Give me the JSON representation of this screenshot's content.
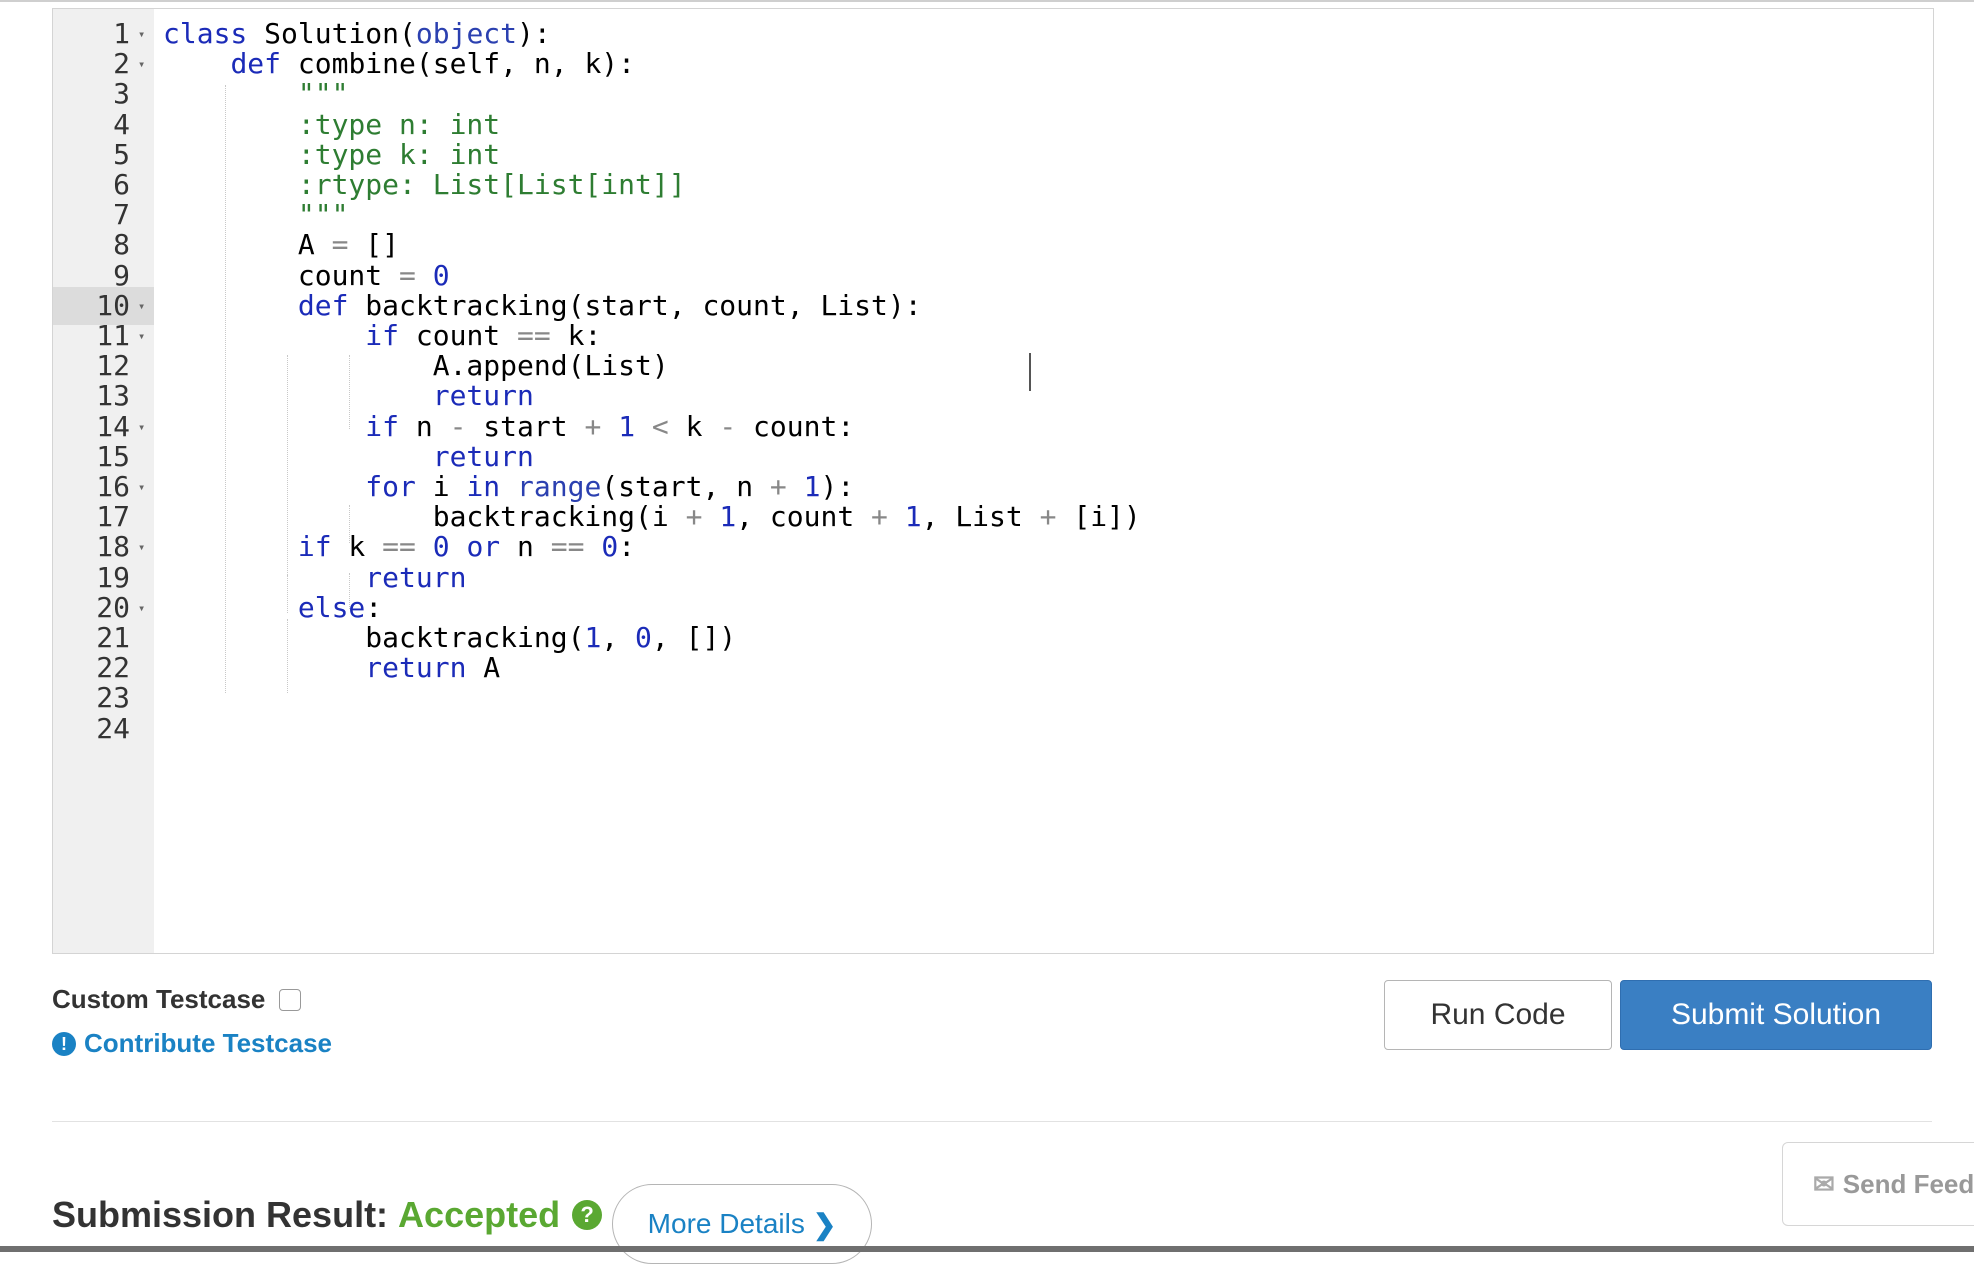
{
  "editor": {
    "gutter": [
      {
        "num": "1",
        "fold": true
      },
      {
        "num": "2",
        "fold": true
      },
      {
        "num": "3",
        "fold": false
      },
      {
        "num": "4",
        "fold": false
      },
      {
        "num": "5",
        "fold": false
      },
      {
        "num": "6",
        "fold": false
      },
      {
        "num": "7",
        "fold": false
      },
      {
        "num": "8",
        "fold": false
      },
      {
        "num": "9",
        "fold": false
      },
      {
        "num": "10",
        "fold": true,
        "active": true
      },
      {
        "num": "11",
        "fold": true
      },
      {
        "num": "12",
        "fold": false
      },
      {
        "num": "13",
        "fold": false
      },
      {
        "num": "14",
        "fold": true
      },
      {
        "num": "15",
        "fold": false
      },
      {
        "num": "16",
        "fold": true
      },
      {
        "num": "17",
        "fold": false
      },
      {
        "num": "18",
        "fold": true
      },
      {
        "num": "19",
        "fold": false
      },
      {
        "num": "20",
        "fold": true
      },
      {
        "num": "21",
        "fold": false
      },
      {
        "num": "22",
        "fold": false
      },
      {
        "num": "23",
        "fold": false
      },
      {
        "num": "24",
        "fold": false
      }
    ],
    "lines": [
      [
        [
          "k",
          "class"
        ],
        [
          "t",
          " Solution("
        ],
        [
          "f",
          "object"
        ],
        [
          "t",
          "):"
        ]
      ],
      [
        [
          "t",
          "    "
        ],
        [
          "k",
          "def"
        ],
        [
          "t",
          " combine(self, n, k):"
        ]
      ],
      [
        [
          "t",
          "        "
        ],
        [
          "s",
          "\"\"\""
        ]
      ],
      [
        [
          "t",
          "        "
        ],
        [
          "s",
          ":type n: int"
        ]
      ],
      [
        [
          "t",
          "        "
        ],
        [
          "s",
          ":type k: int"
        ]
      ],
      [
        [
          "t",
          "        "
        ],
        [
          "s",
          ":rtype: List[List[int]]"
        ]
      ],
      [
        [
          "t",
          "        "
        ],
        [
          "s",
          "\"\"\""
        ]
      ],
      [
        [
          "t",
          "        A "
        ],
        [
          "o",
          "="
        ],
        [
          "t",
          " []"
        ]
      ],
      [
        [
          "t",
          "        count "
        ],
        [
          "o",
          "="
        ],
        [
          "t",
          " "
        ],
        [
          "n",
          "0"
        ]
      ],
      [
        [
          "t",
          "        "
        ],
        [
          "k",
          "def"
        ],
        [
          "t",
          " backtracking(start, count, List):"
        ]
      ],
      [
        [
          "t",
          "            "
        ],
        [
          "k",
          "if"
        ],
        [
          "t",
          " count "
        ],
        [
          "o",
          "=="
        ],
        [
          "t",
          " k:"
        ]
      ],
      [
        [
          "t",
          "                A.append(List)"
        ]
      ],
      [
        [
          "t",
          "                "
        ],
        [
          "k",
          "return"
        ]
      ],
      [
        [
          "t",
          "            "
        ],
        [
          "k",
          "if"
        ],
        [
          "t",
          " n "
        ],
        [
          "o",
          "-"
        ],
        [
          "t",
          " start "
        ],
        [
          "o",
          "+"
        ],
        [
          "t",
          " "
        ],
        [
          "n",
          "1"
        ],
        [
          "t",
          " "
        ],
        [
          "o",
          "<"
        ],
        [
          "t",
          " k "
        ],
        [
          "o",
          "-"
        ],
        [
          "t",
          " count:"
        ]
      ],
      [
        [
          "t",
          "                "
        ],
        [
          "k",
          "return"
        ]
      ],
      [
        [
          "t",
          "            "
        ],
        [
          "k",
          "for"
        ],
        [
          "t",
          " i "
        ],
        [
          "k",
          "in"
        ],
        [
          "t",
          " "
        ],
        [
          "f",
          "range"
        ],
        [
          "t",
          "(start, n "
        ],
        [
          "o",
          "+"
        ],
        [
          "t",
          " "
        ],
        [
          "n",
          "1"
        ],
        [
          "t",
          "):"
        ]
      ],
      [
        [
          "t",
          "                backtracking(i "
        ],
        [
          "o",
          "+"
        ],
        [
          "t",
          " "
        ],
        [
          "n",
          "1"
        ],
        [
          "t",
          ", count "
        ],
        [
          "o",
          "+"
        ],
        [
          "t",
          " "
        ],
        [
          "n",
          "1"
        ],
        [
          "t",
          ", List "
        ],
        [
          "o",
          "+"
        ],
        [
          "t",
          " [i])"
        ]
      ],
      [
        [
          "t",
          "        "
        ],
        [
          "k",
          "if"
        ],
        [
          "t",
          " k "
        ],
        [
          "o",
          "=="
        ],
        [
          "t",
          " "
        ],
        [
          "n",
          "0"
        ],
        [
          "t",
          " "
        ],
        [
          "k",
          "or"
        ],
        [
          "t",
          " n "
        ],
        [
          "o",
          "=="
        ],
        [
          "t",
          " "
        ],
        [
          "n",
          "0"
        ],
        [
          "t",
          ":"
        ]
      ],
      [
        [
          "t",
          "            "
        ],
        [
          "k",
          "return"
        ]
      ],
      [
        [
          "t",
          "        "
        ],
        [
          "k",
          "else"
        ],
        [
          "t",
          ":"
        ]
      ],
      [
        [
          "t",
          "            backtracking("
        ],
        [
          "n",
          "1"
        ],
        [
          "t",
          ", "
        ],
        [
          "n",
          "0"
        ],
        [
          "t",
          ", [])"
        ]
      ],
      [
        [
          "t",
          "            "
        ],
        [
          "k",
          "return"
        ],
        [
          "t",
          " A"
        ]
      ],
      [
        [
          "t",
          ""
        ]
      ],
      [
        [
          "t",
          ""
        ]
      ]
    ]
  },
  "controls": {
    "custom_testcase_label": "Custom Testcase",
    "contribute_label": "Contribute Testcase",
    "contribute_icon": "!",
    "run_label": "Run Code",
    "submit_label": "Submit Solution"
  },
  "result": {
    "label": "Submission Result:",
    "status": "Accepted",
    "help_icon": "?",
    "more_details": "More Details",
    "more_details_chevron": "❯"
  },
  "feedback": {
    "label": "Send Feedback",
    "icon": "✉"
  },
  "colors": {
    "keyword": "#1b2bb8",
    "string": "#2e7d32",
    "accepted": "#5aa832",
    "link": "#1a82c4",
    "submit_button": "#3a7fc3"
  }
}
